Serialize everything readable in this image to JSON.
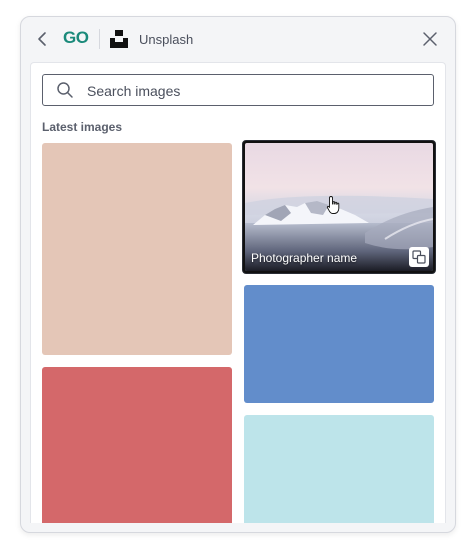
{
  "header": {
    "back_icon": "chevron-left-icon",
    "brand_logo_text": "GO",
    "provider_name": "Unsplash",
    "provider_icon": "unsplash-icon",
    "close_icon": "close-icon"
  },
  "search": {
    "placeholder": "Search images",
    "value": "",
    "icon": "search-icon"
  },
  "section": {
    "title": "Latest images"
  },
  "tiles": [
    {
      "id": "tile-1",
      "color": "#e4c6b7"
    },
    {
      "id": "tile-2",
      "type": "photo",
      "photographer": "Photographer name",
      "action_icon": "copy-icon",
      "hovered": true
    },
    {
      "id": "tile-3",
      "color": "#d4686a"
    },
    {
      "id": "tile-4",
      "color": "#628dcb"
    },
    {
      "id": "tile-5",
      "color": "#bde4ea"
    }
  ],
  "colors": {
    "brand": "#1b8a7b",
    "panel_bg": "#f4f5f7",
    "border": "#d6d8de"
  }
}
